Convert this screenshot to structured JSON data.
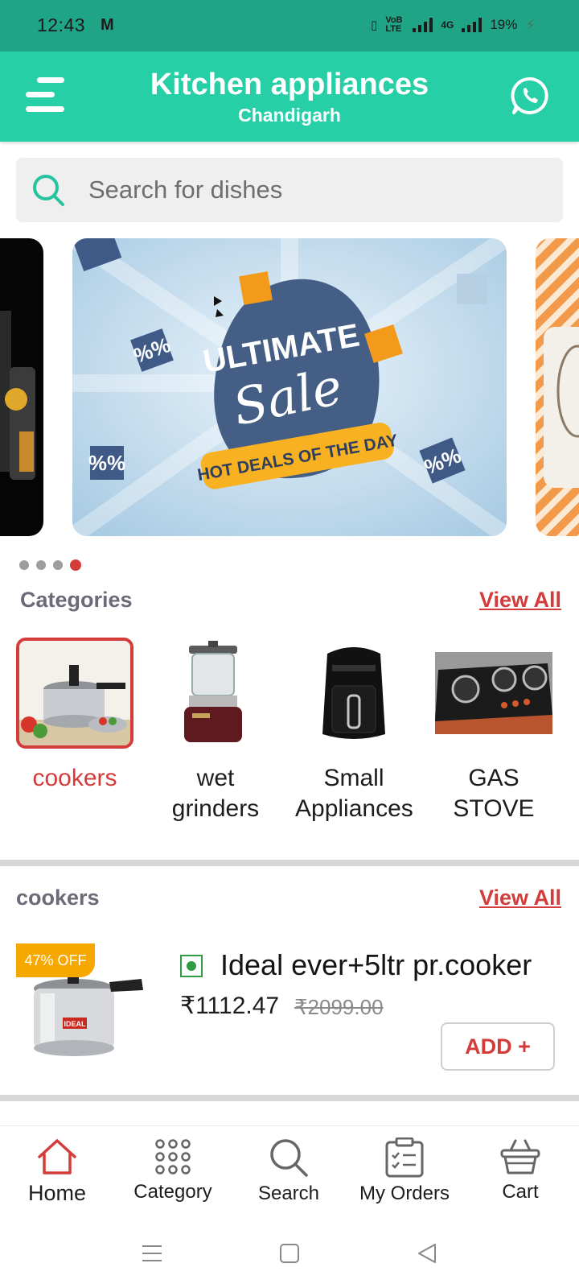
{
  "status_bar": {
    "time": "12:43",
    "mail_glyph": "M",
    "volte": "VoB LTE",
    "network": "4G",
    "battery": "19%"
  },
  "header": {
    "title": "Kitchen appliances",
    "subtitle": "Chandigarh"
  },
  "search": {
    "placeholder": "Search for dishes"
  },
  "banner": {
    "line1": "ULTIMATE",
    "line2": "Sale",
    "ribbon": "HOT DEALS OF THE DAY",
    "badge": "%%"
  },
  "carousel": {
    "count": 4,
    "active_index": 3
  },
  "categories_section": {
    "title": "Categories",
    "view_all": "View All",
    "items": [
      {
        "line1": "cookers",
        "line2": "",
        "selected": true
      },
      {
        "line1": "wet",
        "line2": "grinders",
        "selected": false
      },
      {
        "line1": "Small",
        "line2": "Appliances",
        "selected": false
      },
      {
        "line1": "GAS",
        "line2": "STOVE",
        "selected": false
      }
    ]
  },
  "cookers_section": {
    "title": "cookers",
    "view_all": "View All",
    "product": {
      "discount": "47% OFF",
      "brand_label": "IDEAL",
      "name": "Ideal ever+5ltr pr.cooker",
      "price": "₹1112.47",
      "mrp": "₹2099.00",
      "add_label": "ADD +"
    }
  },
  "bottom_nav": [
    {
      "label": "Home",
      "active": true
    },
    {
      "label": "Category",
      "active": false
    },
    {
      "label": "Search",
      "active": false
    },
    {
      "label": "My Orders",
      "active": false
    },
    {
      "label": "Cart",
      "active": false
    }
  ],
  "colors": {
    "primary": "#26cfa6",
    "status_bar": "#1fa585",
    "accent_red": "#d43b3b",
    "badge_orange": "#f7a800"
  }
}
